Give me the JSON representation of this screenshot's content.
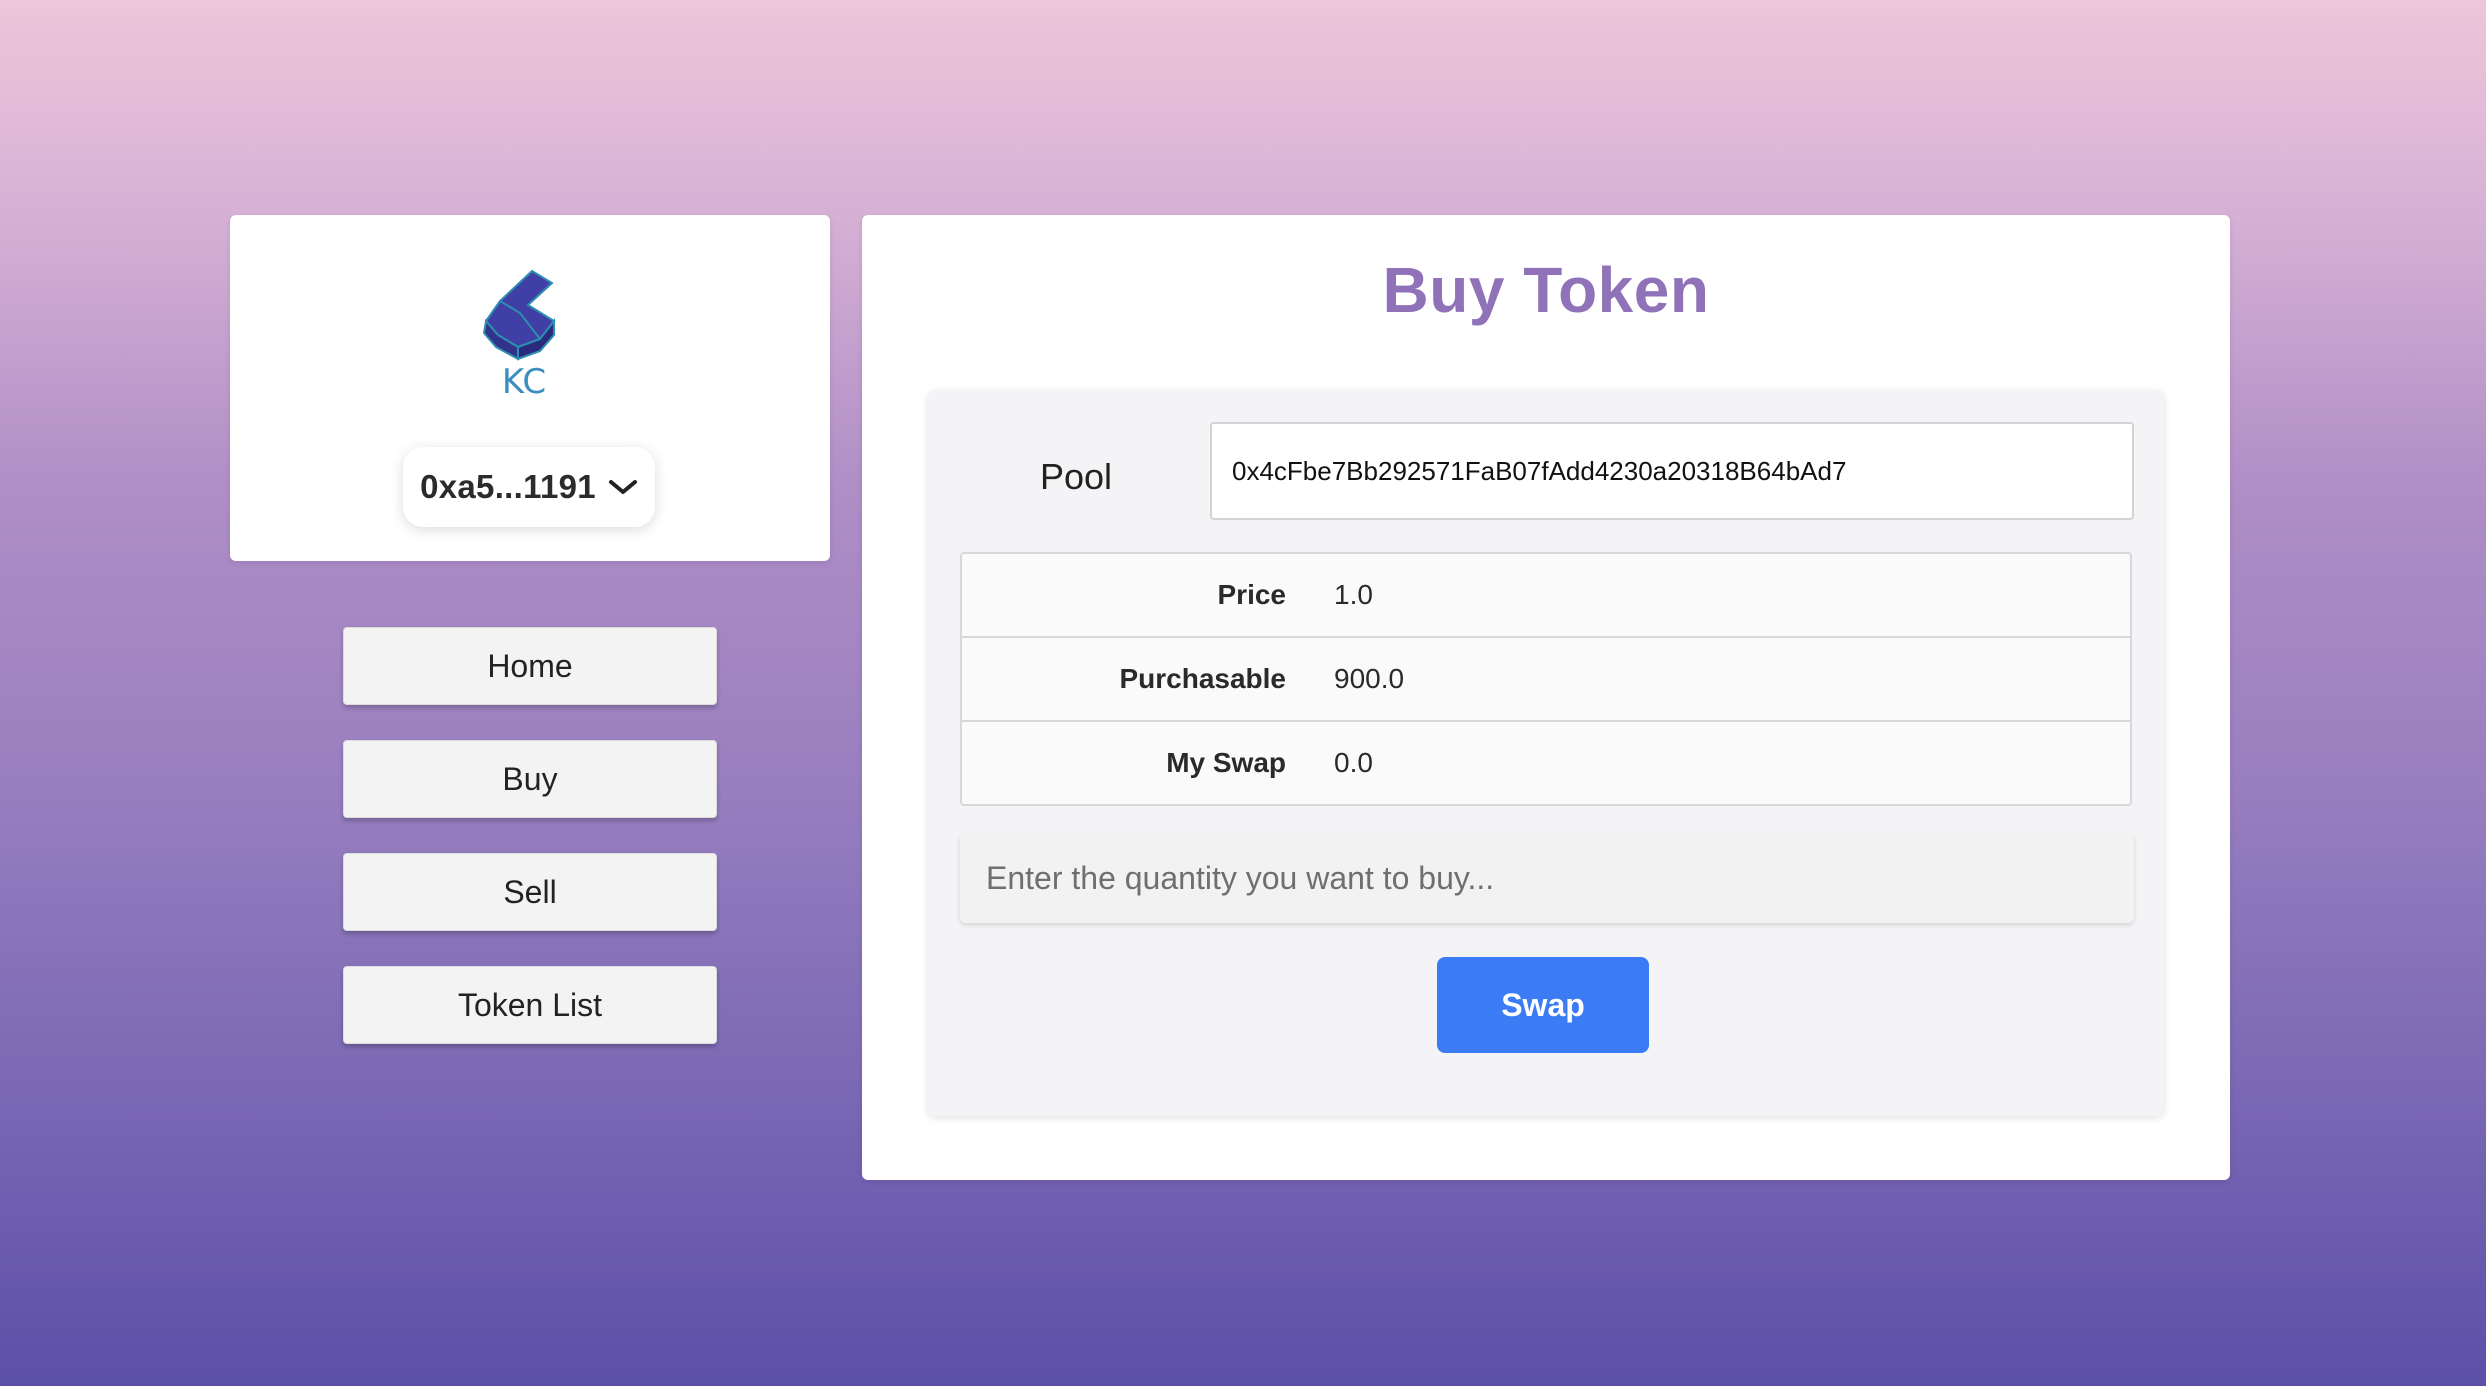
{
  "sidebar": {
    "logo_text": "KC",
    "wallet_address": "0xa5...1191",
    "nav": {
      "home": "Home",
      "buy": "Buy",
      "sell": "Sell",
      "token_list": "Token List"
    }
  },
  "main": {
    "title": "Buy Token",
    "pool": {
      "label": "Pool",
      "value": "0x4cFbe7Bb292571FaB07fAdd4230a20318B64bAd7"
    },
    "info": [
      {
        "key": "Price",
        "value": "1.0"
      },
      {
        "key": "Purchasable",
        "value": "900.0"
      },
      {
        "key": "My Swap",
        "value": "0.0"
      }
    ],
    "quantity_placeholder": "Enter the quantity you want to buy...",
    "swap_label": "Swap"
  },
  "colors": {
    "title": "#8f72b8",
    "swap_button": "#3b7cf5",
    "logo_block": "#3f3fa6",
    "logo_text": "#3a8fc0",
    "background_top": "#edc6da",
    "background_bottom": "#5c4fa8"
  },
  "icons": {
    "logo": "kc-logo",
    "wallet_dropdown": "chevron-down-icon"
  }
}
